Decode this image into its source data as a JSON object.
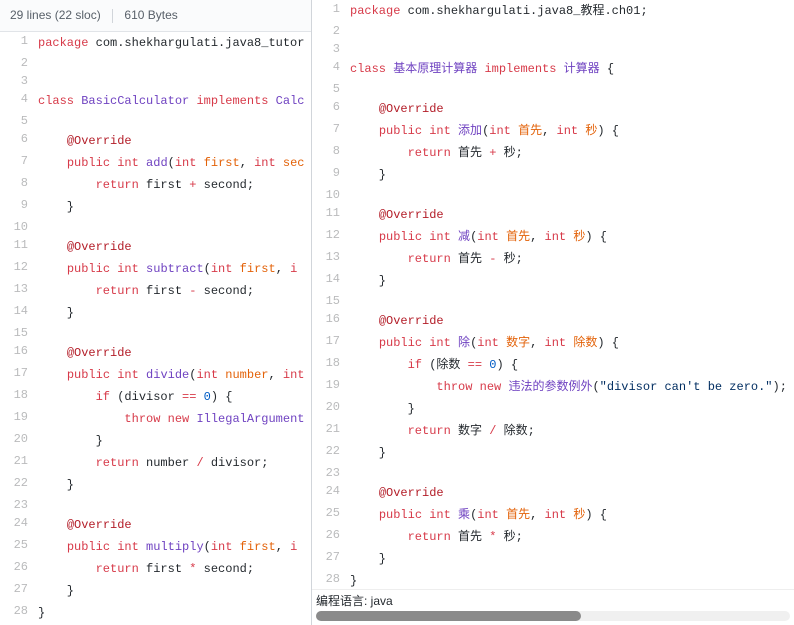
{
  "left": {
    "header": {
      "lines_label": "29 lines (22 sloc)",
      "size_label": "610 Bytes"
    },
    "code": [
      {
        "n": 1,
        "t": [
          [
            "kw",
            "package"
          ],
          [
            "pkg",
            " com.shekhargulati.java8_tutor"
          ]
        ]
      },
      {
        "n": 2,
        "t": []
      },
      {
        "n": 3,
        "t": []
      },
      {
        "n": 4,
        "t": [
          [
            "kw",
            "class"
          ],
          [
            "",
            ""
          ],
          [
            "",
            " "
          ],
          [
            "cls",
            "BasicCalculator"
          ],
          [
            "",
            " "
          ],
          [
            "kw",
            "implements"
          ],
          [
            "",
            " "
          ],
          [
            "cls",
            "Calc"
          ]
        ]
      },
      {
        "n": 5,
        "t": []
      },
      {
        "n": 6,
        "t": [
          [
            "",
            "    "
          ],
          [
            "ann",
            "@Override"
          ]
        ]
      },
      {
        "n": 7,
        "t": [
          [
            "",
            "    "
          ],
          [
            "kw",
            "public"
          ],
          [
            "",
            " "
          ],
          [
            "type",
            "int"
          ],
          [
            "",
            " "
          ],
          [
            "mth",
            "add"
          ],
          [
            "",
            "("
          ],
          [
            "type",
            "int"
          ],
          [
            "",
            " "
          ],
          [
            "param",
            "first"
          ],
          [
            "",
            ", "
          ],
          [
            "type",
            "int"
          ],
          [
            "",
            " "
          ],
          [
            "param",
            "sec"
          ]
        ]
      },
      {
        "n": 8,
        "t": [
          [
            "",
            "        "
          ],
          [
            "kw",
            "return"
          ],
          [
            "",
            " first "
          ],
          [
            "op",
            "+"
          ],
          [
            "",
            " second;"
          ]
        ]
      },
      {
        "n": 9,
        "t": [
          [
            "",
            "    }"
          ]
        ]
      },
      {
        "n": 10,
        "t": []
      },
      {
        "n": 11,
        "t": [
          [
            "",
            "    "
          ],
          [
            "ann",
            "@Override"
          ]
        ]
      },
      {
        "n": 12,
        "t": [
          [
            "",
            "    "
          ],
          [
            "kw",
            "public"
          ],
          [
            "",
            " "
          ],
          [
            "type",
            "int"
          ],
          [
            "",
            " "
          ],
          [
            "mth",
            "subtract"
          ],
          [
            "",
            "("
          ],
          [
            "type",
            "int"
          ],
          [
            "",
            " "
          ],
          [
            "param",
            "first"
          ],
          [
            "",
            ", "
          ],
          [
            "type",
            "i"
          ]
        ]
      },
      {
        "n": 13,
        "t": [
          [
            "",
            "        "
          ],
          [
            "kw",
            "return"
          ],
          [
            "",
            " first "
          ],
          [
            "op",
            "-"
          ],
          [
            "",
            " second;"
          ]
        ]
      },
      {
        "n": 14,
        "t": [
          [
            "",
            "    }"
          ]
        ]
      },
      {
        "n": 15,
        "t": []
      },
      {
        "n": 16,
        "t": [
          [
            "",
            "    "
          ],
          [
            "ann",
            "@Override"
          ]
        ]
      },
      {
        "n": 17,
        "t": [
          [
            "",
            "    "
          ],
          [
            "kw",
            "public"
          ],
          [
            "",
            " "
          ],
          [
            "type",
            "int"
          ],
          [
            "",
            " "
          ],
          [
            "mth",
            "divide"
          ],
          [
            "",
            "("
          ],
          [
            "type",
            "int"
          ],
          [
            "",
            " "
          ],
          [
            "param",
            "number"
          ],
          [
            "",
            ", "
          ],
          [
            "type",
            "int"
          ]
        ]
      },
      {
        "n": 18,
        "t": [
          [
            "",
            "        "
          ],
          [
            "kw",
            "if"
          ],
          [
            "",
            " (divisor "
          ],
          [
            "op",
            "=="
          ],
          [
            "",
            " "
          ],
          [
            "num",
            "0"
          ],
          [
            "",
            ") {"
          ]
        ]
      },
      {
        "n": 19,
        "t": [
          [
            "",
            "            "
          ],
          [
            "kw",
            "throw"
          ],
          [
            "",
            " "
          ],
          [
            "kw",
            "new"
          ],
          [
            "",
            " "
          ],
          [
            "cls",
            "IllegalArgument"
          ]
        ]
      },
      {
        "n": 20,
        "t": [
          [
            "",
            "        }"
          ]
        ]
      },
      {
        "n": 21,
        "t": [
          [
            "",
            "        "
          ],
          [
            "kw",
            "return"
          ],
          [
            "",
            " number "
          ],
          [
            "op",
            "/"
          ],
          [
            "",
            " divisor;"
          ]
        ]
      },
      {
        "n": 22,
        "t": [
          [
            "",
            "    }"
          ]
        ]
      },
      {
        "n": 23,
        "t": []
      },
      {
        "n": 24,
        "t": [
          [
            "",
            "    "
          ],
          [
            "ann",
            "@Override"
          ]
        ]
      },
      {
        "n": 25,
        "t": [
          [
            "",
            "    "
          ],
          [
            "kw",
            "public"
          ],
          [
            "",
            " "
          ],
          [
            "type",
            "int"
          ],
          [
            "",
            " "
          ],
          [
            "mth",
            "multiply"
          ],
          [
            "",
            "("
          ],
          [
            "type",
            "int"
          ],
          [
            "",
            " "
          ],
          [
            "param",
            "first"
          ],
          [
            "",
            ", "
          ],
          [
            "type",
            "i"
          ]
        ]
      },
      {
        "n": 26,
        "t": [
          [
            "",
            "        "
          ],
          [
            "kw",
            "return"
          ],
          [
            "",
            " first "
          ],
          [
            "op",
            "*"
          ],
          [
            "",
            " second;"
          ]
        ]
      },
      {
        "n": 27,
        "t": [
          [
            "",
            "    }"
          ]
        ]
      },
      {
        "n": 28,
        "t": [
          [
            "",
            "}"
          ]
        ]
      }
    ]
  },
  "right": {
    "footer_label": "编程语言: java",
    "code": [
      {
        "n": 1,
        "t": [
          [
            "kw",
            "package"
          ],
          [
            "pkg",
            " com.shekhargulati.java8_教程.ch01;"
          ]
        ]
      },
      {
        "n": 2,
        "t": []
      },
      {
        "n": 3,
        "t": []
      },
      {
        "n": 4,
        "t": [
          [
            "kw",
            "class"
          ],
          [
            "",
            " "
          ],
          [
            "cls",
            "基本原理计算器"
          ],
          [
            "",
            " "
          ],
          [
            "kw",
            "implements"
          ],
          [
            "",
            " "
          ],
          [
            "cls",
            "计算器"
          ],
          [
            "",
            " {"
          ]
        ]
      },
      {
        "n": 5,
        "t": []
      },
      {
        "n": 6,
        "t": [
          [
            "",
            "    "
          ],
          [
            "ann",
            "@Override"
          ]
        ]
      },
      {
        "n": 7,
        "t": [
          [
            "",
            "    "
          ],
          [
            "kw",
            "public"
          ],
          [
            "",
            " "
          ],
          [
            "type",
            "int"
          ],
          [
            "",
            " "
          ],
          [
            "mth",
            "添加"
          ],
          [
            "",
            "("
          ],
          [
            "type",
            "int"
          ],
          [
            "",
            " "
          ],
          [
            "param",
            "首先"
          ],
          [
            "",
            ", "
          ],
          [
            "type",
            "int"
          ],
          [
            "",
            " "
          ],
          [
            "param",
            "秒"
          ],
          [
            "",
            ") {"
          ]
        ]
      },
      {
        "n": 8,
        "t": [
          [
            "",
            "        "
          ],
          [
            "kw",
            "return"
          ],
          [
            "",
            " 首先 "
          ],
          [
            "op",
            "+"
          ],
          [
            "",
            " 秒;"
          ]
        ]
      },
      {
        "n": 9,
        "t": [
          [
            "",
            "    }"
          ]
        ]
      },
      {
        "n": 10,
        "t": []
      },
      {
        "n": 11,
        "t": [
          [
            "",
            "    "
          ],
          [
            "ann",
            "@Override"
          ]
        ]
      },
      {
        "n": 12,
        "t": [
          [
            "",
            "    "
          ],
          [
            "kw",
            "public"
          ],
          [
            "",
            " "
          ],
          [
            "type",
            "int"
          ],
          [
            "",
            " "
          ],
          [
            "mth",
            "减"
          ],
          [
            "",
            "("
          ],
          [
            "type",
            "int"
          ],
          [
            "",
            " "
          ],
          [
            "param",
            "首先"
          ],
          [
            "",
            ", "
          ],
          [
            "type",
            "int"
          ],
          [
            "",
            " "
          ],
          [
            "param",
            "秒"
          ],
          [
            "",
            ") {"
          ]
        ]
      },
      {
        "n": 13,
        "t": [
          [
            "",
            "        "
          ],
          [
            "kw",
            "return"
          ],
          [
            "",
            " 首先 "
          ],
          [
            "op",
            "-"
          ],
          [
            "",
            " 秒;"
          ]
        ]
      },
      {
        "n": 14,
        "t": [
          [
            "",
            "    }"
          ]
        ]
      },
      {
        "n": 15,
        "t": []
      },
      {
        "n": 16,
        "t": [
          [
            "",
            "    "
          ],
          [
            "ann",
            "@Override"
          ]
        ]
      },
      {
        "n": 17,
        "t": [
          [
            "",
            "    "
          ],
          [
            "kw",
            "public"
          ],
          [
            "",
            " "
          ],
          [
            "type",
            "int"
          ],
          [
            "",
            " "
          ],
          [
            "mth",
            "除"
          ],
          [
            "",
            "("
          ],
          [
            "type",
            "int"
          ],
          [
            "",
            " "
          ],
          [
            "param",
            "数字"
          ],
          [
            "",
            ", "
          ],
          [
            "type",
            "int"
          ],
          [
            "",
            " "
          ],
          [
            "param",
            "除数"
          ],
          [
            "",
            ") {"
          ]
        ]
      },
      {
        "n": 18,
        "t": [
          [
            "",
            "        "
          ],
          [
            "kw",
            "if"
          ],
          [
            "",
            " (除数 "
          ],
          [
            "op",
            "=="
          ],
          [
            "",
            " "
          ],
          [
            "num",
            "0"
          ],
          [
            "",
            ") {"
          ]
        ]
      },
      {
        "n": 19,
        "t": [
          [
            "",
            "            "
          ],
          [
            "kw",
            "throw"
          ],
          [
            "",
            " "
          ],
          [
            "kw",
            "new"
          ],
          [
            "",
            " "
          ],
          [
            "cls",
            "违法的参数例外"
          ],
          [
            "",
            "("
          ],
          [
            "str",
            "\"divisor can't be zero.\""
          ],
          [
            "",
            ");"
          ]
        ]
      },
      {
        "n": 20,
        "t": [
          [
            "",
            "        }"
          ]
        ]
      },
      {
        "n": 21,
        "t": [
          [
            "",
            "        "
          ],
          [
            "kw",
            "return"
          ],
          [
            "",
            " 数字 "
          ],
          [
            "op",
            "/"
          ],
          [
            "",
            " 除数;"
          ]
        ]
      },
      {
        "n": 22,
        "t": [
          [
            "",
            "    }"
          ]
        ]
      },
      {
        "n": 23,
        "t": []
      },
      {
        "n": 24,
        "t": [
          [
            "",
            "    "
          ],
          [
            "ann",
            "@Override"
          ]
        ]
      },
      {
        "n": 25,
        "t": [
          [
            "",
            "    "
          ],
          [
            "kw",
            "public"
          ],
          [
            "",
            " "
          ],
          [
            "type",
            "int"
          ],
          [
            "",
            " "
          ],
          [
            "mth",
            "乘"
          ],
          [
            "",
            "("
          ],
          [
            "type",
            "int"
          ],
          [
            "",
            " "
          ],
          [
            "param",
            "首先"
          ],
          [
            "",
            ", "
          ],
          [
            "type",
            "int"
          ],
          [
            "",
            " "
          ],
          [
            "param",
            "秒"
          ],
          [
            "",
            ") {"
          ]
        ]
      },
      {
        "n": 26,
        "t": [
          [
            "",
            "        "
          ],
          [
            "kw",
            "return"
          ],
          [
            "",
            " 首先 "
          ],
          [
            "op",
            "*"
          ],
          [
            "",
            " 秒;"
          ]
        ]
      },
      {
        "n": 27,
        "t": [
          [
            "",
            "    }"
          ]
        ]
      },
      {
        "n": 28,
        "t": [
          [
            "",
            "}"
          ]
        ]
      }
    ]
  }
}
